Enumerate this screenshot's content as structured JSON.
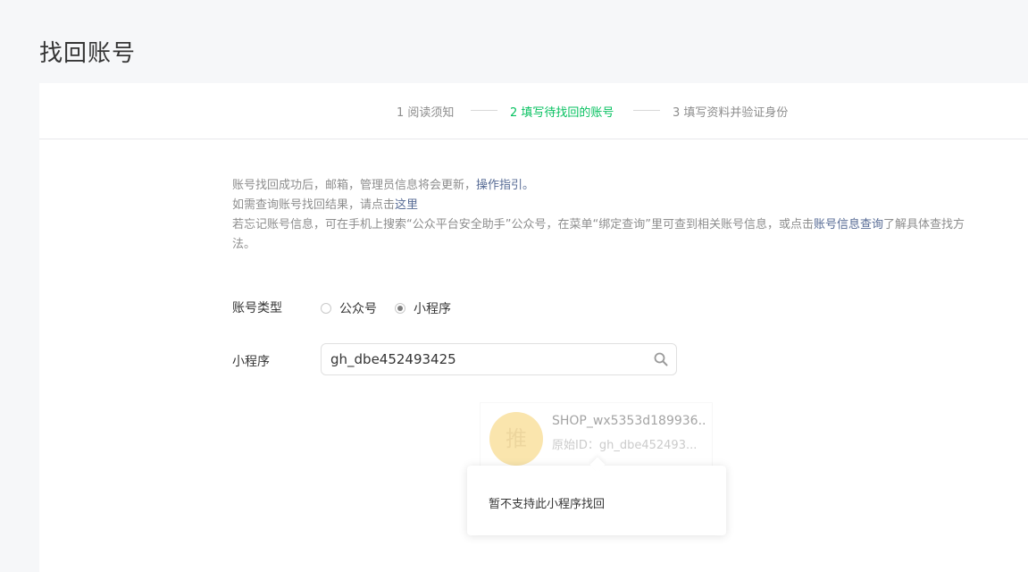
{
  "page": {
    "title": "找回账号"
  },
  "steps": [
    {
      "label": "1 阅读须知",
      "active": false
    },
    {
      "label": "2 填写待找回的账号",
      "active": true
    },
    {
      "label": "3 填写资料并验证身份",
      "active": false
    }
  ],
  "notice": {
    "line1_text": "账号找回成功后，邮箱，管理员信息将会更新，",
    "line1_link": "操作指引。",
    "line2_text": "如需查询账号找回结果，请点击",
    "line2_link": "这里",
    "line3_text": "若忘记账号信息，可在手机上搜索“公众平台安全助手”公众号，在菜单“绑定查询”里可查到相关账号信息，或点击",
    "line3_link": "账号信息查询",
    "line3_tail": "了解具体查找方法。"
  },
  "form": {
    "account_type_label": "账号类型",
    "options": [
      {
        "label": "公众号",
        "checked": false
      },
      {
        "label": "小程序",
        "checked": true
      }
    ],
    "search_label": "小程序",
    "search_value": "gh_dbe452493425"
  },
  "result": {
    "avatar_text": "推",
    "name": "SHOP_wx5353d189936...",
    "original_id": "原始ID：gh_dbe452493..."
  },
  "tooltip": {
    "text": "暂不支持此小程序找回"
  },
  "colors": {
    "accent": "#07c160",
    "link": "#576b95"
  },
  "icons": {
    "search": "search-icon"
  }
}
